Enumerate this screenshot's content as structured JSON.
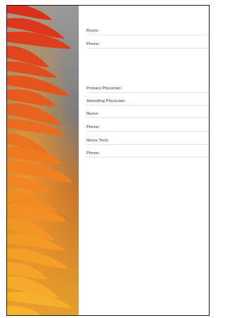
{
  "form": {
    "fields": [
      {
        "label": "Room:"
      },
      {
        "label": "Phone:"
      },
      {
        "label": "Primary Physician:"
      },
      {
        "label": "Attending Physician:"
      },
      {
        "label": "Nurse:"
      },
      {
        "label": "Phone:"
      },
      {
        "label": "Nurse Tech:"
      },
      {
        "label": "Phone:"
      }
    ]
  },
  "colors": {
    "background": "#ffffff",
    "border": "#1a1a1a",
    "label": "#6f6f6f",
    "rule": "#e4e4e4",
    "photo_backdrop": "#8a8a8a",
    "petal_red": "#d9301c",
    "petal_orange": "#f07d20",
    "petal_yellow": "#f6b52c"
  }
}
